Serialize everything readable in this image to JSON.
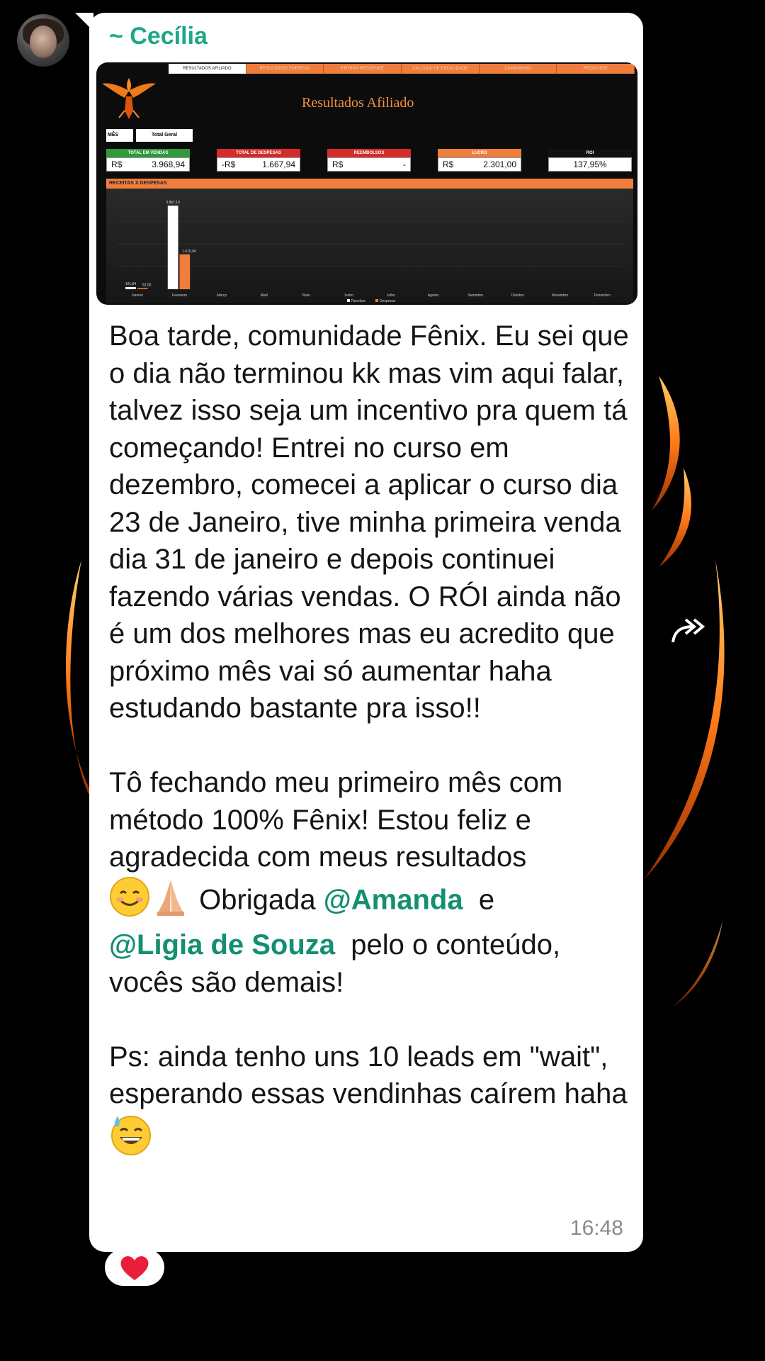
{
  "chat": {
    "sender_name": "~ Cecília",
    "timestamp": "16:48",
    "reaction": "heart"
  },
  "image": {
    "tabs": [
      "RESULTADOS AFILIADO",
      "RESULTADOS EMPRESA",
      "ENTRAR REGUENDE",
      "CÁLCULO DE ESCALIDADE",
      "CAMPANHAS",
      "PRODUTOS"
    ],
    "active_tab_index": 0,
    "title": "Resultados Afiliado",
    "filter": {
      "label": "MÊS",
      "value": "Total Geral"
    },
    "kpis": [
      {
        "label": "TOTAL EM VENDAS",
        "currency": "R$",
        "value": "3.968,94",
        "color": "#2e9a3c"
      },
      {
        "label": "TOTAL DE DESPESAS",
        "currency": "-R$",
        "value": "1.667,94",
        "color": "#d62b2b"
      },
      {
        "label": "REEMBOLSOS",
        "currency": "R$",
        "value": "-",
        "color": "#d62b2b"
      },
      {
        "label": "LUCRO",
        "currency": "R$",
        "value": "2.301,00",
        "color": "#f07d3c"
      },
      {
        "label": "ROI",
        "currency": "",
        "value": "137,95%",
        "color": "#111111"
      }
    ],
    "section_label": "RECEITAS X DESPESAS",
    "chart_data": {
      "type": "bar",
      "categories": [
        "Janeiro",
        "Fevereiro",
        "Março",
        "Abril",
        "Maio",
        "Junho",
        "Julho",
        "Agosto",
        "Setembro",
        "Outubro",
        "Novembro",
        "Dezembro"
      ],
      "series": [
        {
          "name": "Receitas",
          "values": [
            101.84,
            3867.1,
            0,
            0,
            0,
            0,
            0,
            0,
            0,
            0,
            0,
            0
          ],
          "color": "#ffffff"
        },
        {
          "name": "Despesas",
          "values": [
            52.0,
            1615.94,
            0,
            0,
            0,
            0,
            0,
            0,
            0,
            0,
            0,
            0
          ],
          "color": "#f07d3c"
        }
      ],
      "data_labels": {
        "jan_receitas": "101,84",
        "jan_despesas": "52,00",
        "fev_receitas": "3.867,10",
        "fev_despesas": "1.615,94"
      },
      "ylim": [
        0,
        4200
      ],
      "legend": "bottom"
    }
  },
  "message": {
    "p1": "Boa tarde, comunidade Fênix. Eu sei que o dia não terminou kk mas vim aqui falar, talvez isso seja um incentivo pra quem tá começando! Entrei no curso em dezembro, comecei a aplicar o curso dia 23 de Janeiro, tive minha primeira venda dia 31 de janeiro e depois continuei fazendo várias vendas. O RÓI ainda não é um dos melhores mas eu acredito que próximo mês vai só aumentar haha estudando bastante pra isso!!",
    "p2_a": "Tô fechando meu primeiro mês com método 100% Fênix! Estou feliz e agradecida com meus resultados",
    "p2_b": " Obrigada ",
    "mention_1": "@Amanda",
    "p2_c": "  e",
    "mention_2": "@Ligia de Souza",
    "p2_d": "  pelo o conteúdo, vocês são demais!",
    "p3": "Ps: ainda tenho uns 10 leads em \"wait\", esperando essas vendinhas caírem haha"
  },
  "icons": {
    "forward": "forward-icon",
    "emoji_1": "smiling-face-emoji",
    "emoji_2": "folded-hands-emoji",
    "emoji_3": "grinning-sweat-emoji",
    "avatar": "avatar",
    "logo": "phoenix-logo"
  }
}
